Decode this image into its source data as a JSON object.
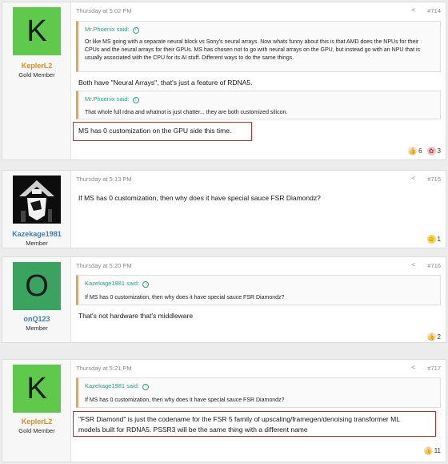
{
  "posts": [
    {
      "username": "KeplerL2",
      "user_title": "Gold Member",
      "avatar_letter": "K",
      "avatar_color": "#5ec94a",
      "username_color": "#e08a1e",
      "date": "Thursday at 5:02 PM",
      "post_number": "#714",
      "quotes": [
        {
          "author": "Mr.Phoenix said:",
          "text": "Or like MS going with a separate neural block vs Sony's neural arrays. Now whats funny about this is that AMD does the NPUs for their CPUs and the neural arrays for their GPUs. MS has chosen not to go with neural arrays on the GPU, but instead go with an NPU that is usually associated with the CPU for its AI stuff. Different ways to do the same things."
        },
        {
          "author": "Mr.Phoenix said:",
          "text": "That whole full rdna and whatnot is just chatter... they are both customized silicon."
        }
      ],
      "body_lines": [
        "Both have \"Neural Arrays\", that's just a feature of RDNA5.",
        "MS has 0 customization on the GPU side this time."
      ],
      "reactions": [
        {
          "icon": "thumbs-up",
          "count": "6"
        },
        {
          "icon": "brain",
          "count": "3"
        }
      ]
    },
    {
      "username": "Kazekage1981",
      "user_title": "Member",
      "date": "Thursday at 5:13 PM",
      "post_number": "#715",
      "username_color": "#3f7fb5",
      "body_lines": [
        "If MS has 0 customization, then why does it have special sauce FSR Diamondz?"
      ],
      "reactions": [
        {
          "icon": "laughing",
          "count": "1"
        }
      ]
    },
    {
      "username": "onQ123",
      "user_title": "Member",
      "avatar_letter": "O",
      "avatar_color": "#3aa35f",
      "username_color": "#3f7fb5",
      "date": "Thursday at 5:20 PM",
      "post_number": "#716",
      "quotes": [
        {
          "author": "Kazekage1981 said:",
          "text": "If MS has 0 customization, then why does it have special sauce FSR Diamondz?"
        }
      ],
      "body_lines": [
        "That's not hardware that's middleware"
      ],
      "reactions": [
        {
          "icon": "thumbs-up",
          "count": "2"
        }
      ]
    },
    {
      "username": "KeplerL2",
      "user_title": "Gold Member",
      "avatar_letter": "K",
      "avatar_color": "#5ec94a",
      "username_color": "#e08a1e",
      "date": "Thursday at 5:21 PM",
      "post_number": "#717",
      "quotes": [
        {
          "author": "Kazekage1981 said:",
          "text": "If MS has 0 customization, then why does it have special sauce FSR Diamondz?"
        }
      ],
      "body_lines": [
        "\"FSR Diamond\" is just the codename for the FSR 5 family of upscaling/framegen/denoising transformer ML",
        "models built for RDNA5. PSSR3 will be the same thing with a different name"
      ],
      "reactions": [
        {
          "icon": "thumbs-up",
          "count": "11"
        }
      ]
    }
  ]
}
